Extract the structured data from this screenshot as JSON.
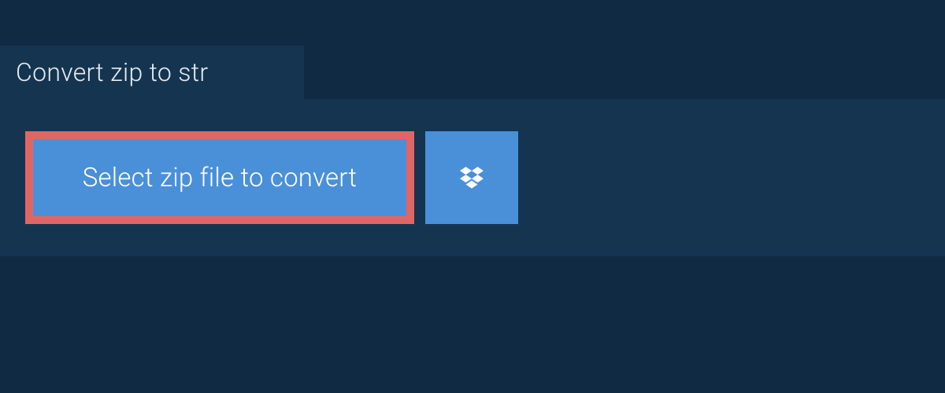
{
  "tab": {
    "title": "Convert zip to str"
  },
  "actions": {
    "select_file_label": "Select zip file to convert"
  },
  "colors": {
    "page_bg": "#102a43",
    "panel_bg": "#153450",
    "button_bg": "#4a90d9",
    "highlight_border": "#e06666",
    "text_light": "#e6ecf2",
    "text_on_button": "#ffffff"
  }
}
